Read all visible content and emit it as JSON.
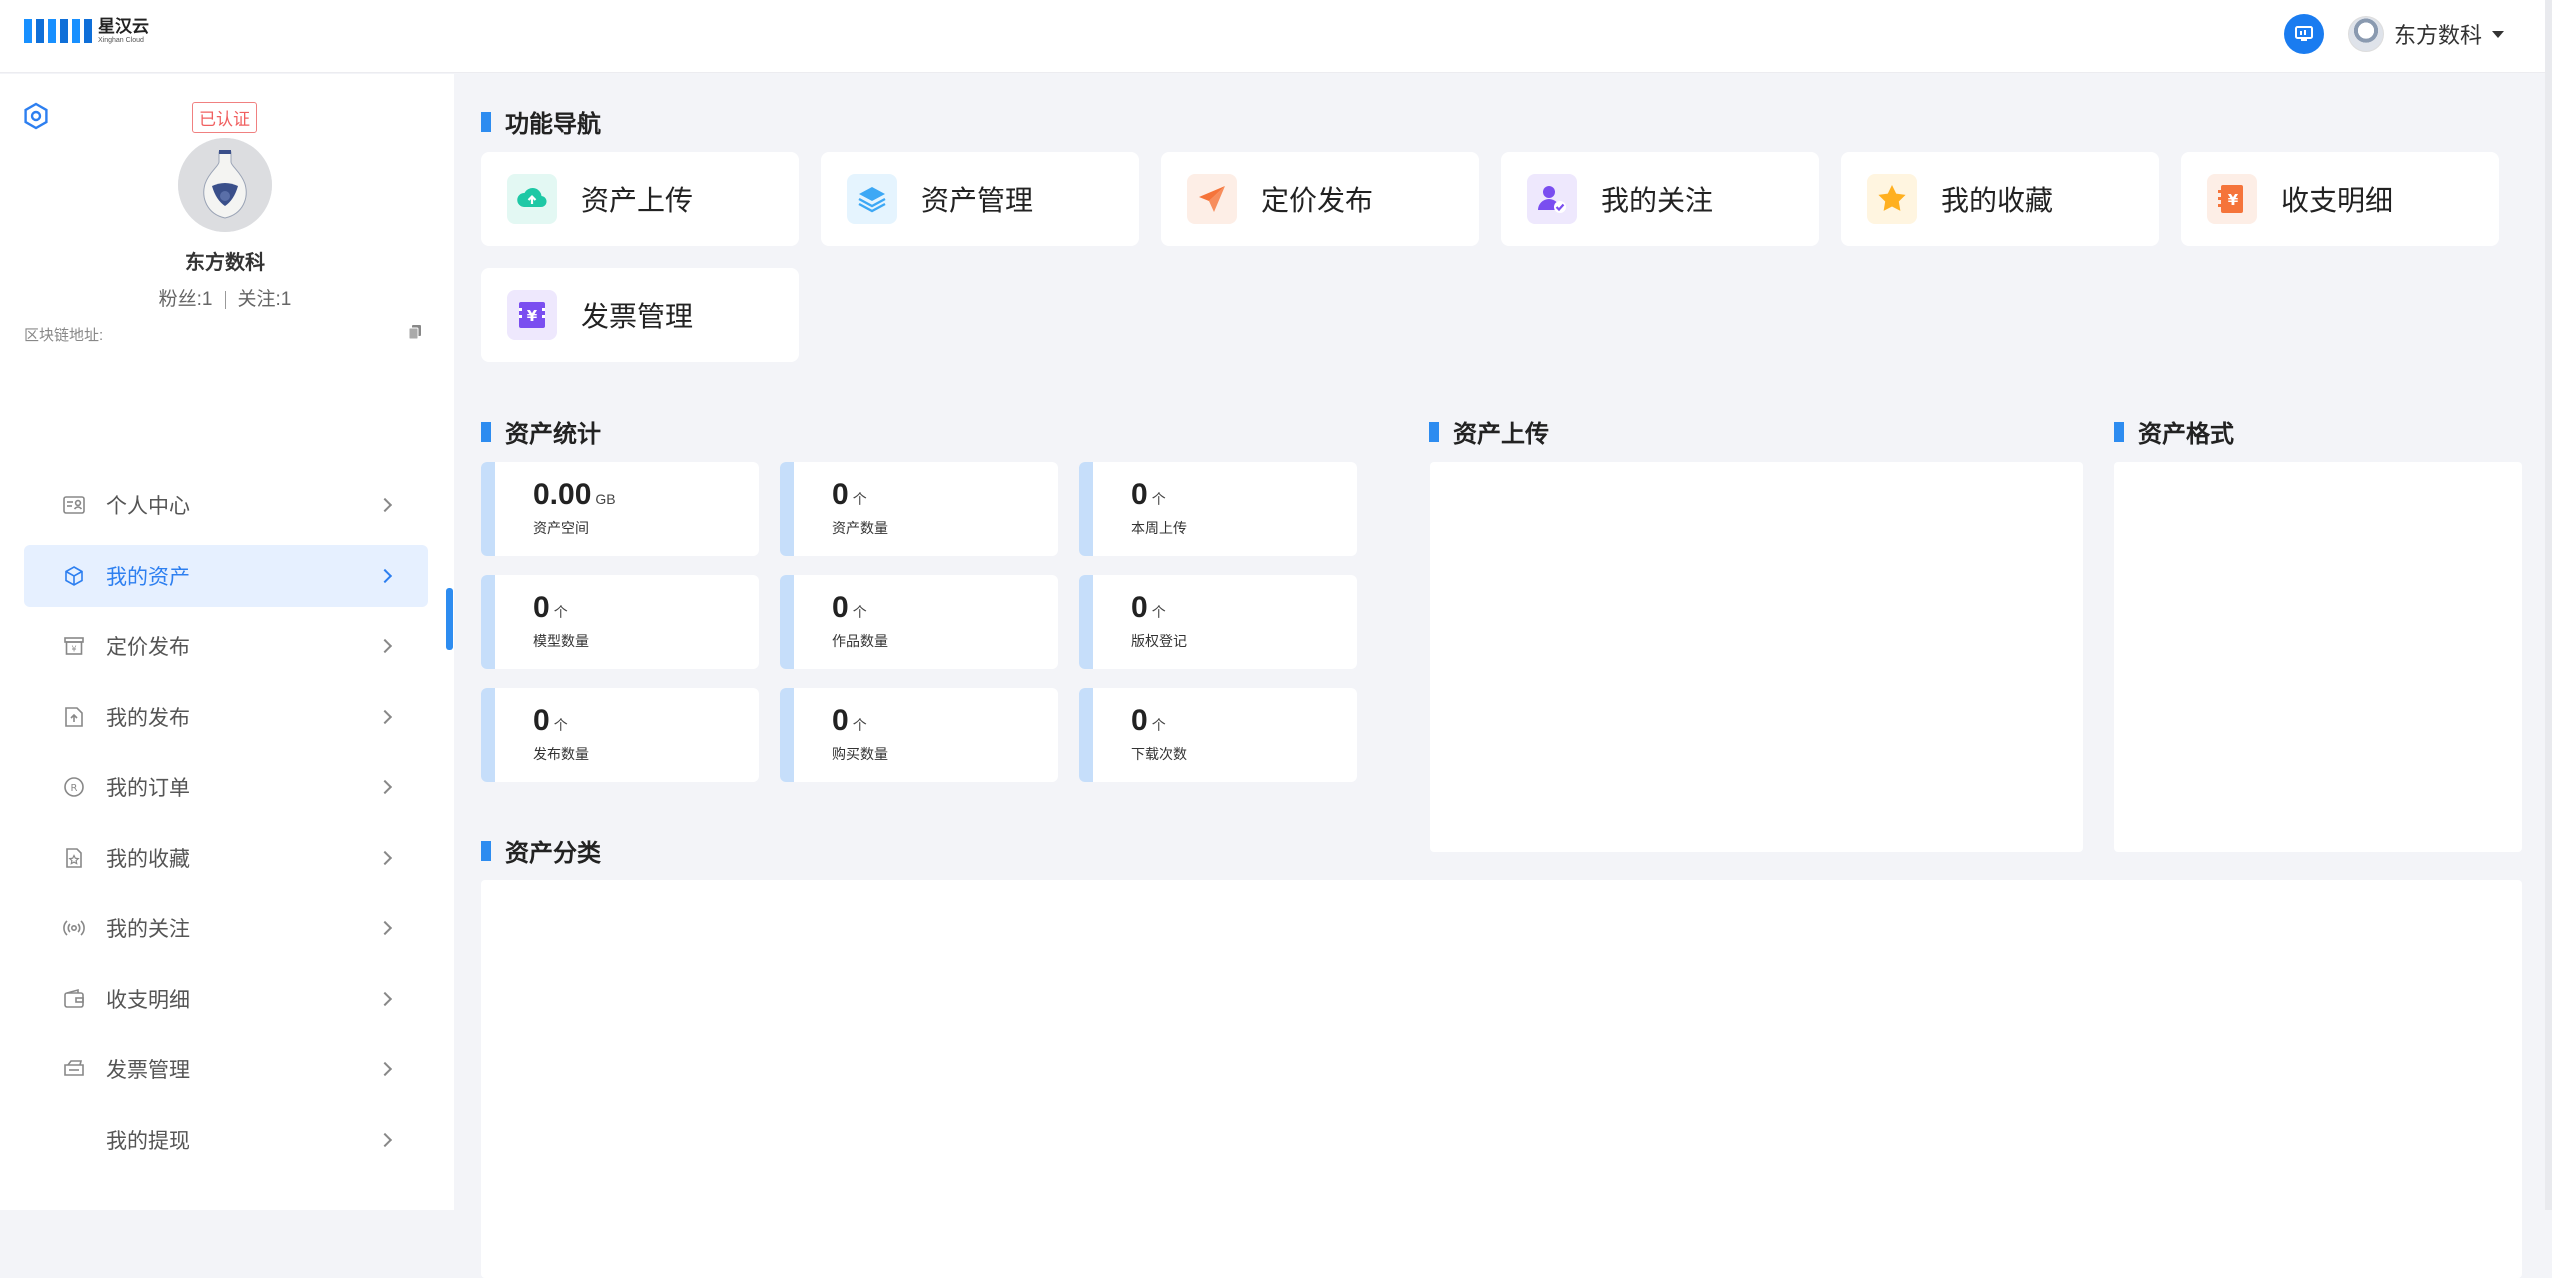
{
  "header": {
    "logo_cn": "星汉云",
    "logo_en": "Xinghan Cloud",
    "user_name": "东方数科"
  },
  "profile": {
    "cert_badge": "已认证",
    "name": "东方数科",
    "fans": "粉丝:1",
    "follow": "关注:1",
    "chain_label": "区块链地址:"
  },
  "sidebar": {
    "items": [
      {
        "label": "个人中心",
        "icon": "id-card-icon"
      },
      {
        "label": "我的资产",
        "icon": "cube-icon"
      },
      {
        "label": "定价发布",
        "icon": "price-tag-icon"
      },
      {
        "label": "我的发布",
        "icon": "upload-folder-icon"
      },
      {
        "label": "我的订单",
        "icon": "order-icon"
      },
      {
        "label": "我的收藏",
        "icon": "star-doc-icon"
      },
      {
        "label": "我的关注",
        "icon": "broadcast-icon"
      },
      {
        "label": "收支明细",
        "icon": "wallet-icon"
      },
      {
        "label": "发票管理",
        "icon": "invoice-icon"
      },
      {
        "label": "我的提现",
        "icon": ""
      }
    ],
    "active_index": 1
  },
  "sections": {
    "nav_title": "功能导航",
    "stats_title": "资产统计",
    "upload_title": "资产上传",
    "format_title": "资产格式",
    "category_title": "资产分类"
  },
  "nav_cards": [
    {
      "label": "资产上传",
      "icon": "cloud-upload-icon",
      "color": "#1ec8a5",
      "bg": "#e3f8f3"
    },
    {
      "label": "资产管理",
      "icon": "layers-icon",
      "color": "#3da8f5",
      "bg": "#e5f4fe"
    },
    {
      "label": "定价发布",
      "icon": "paper-plane-icon",
      "color": "#f5743a",
      "bg": "#fdeee6"
    },
    {
      "label": "我的关注",
      "icon": "user-check-icon",
      "color": "#7a4ef0",
      "bg": "#eee8fd"
    },
    {
      "label": "我的收藏",
      "icon": "star-icon",
      "color": "#ffb020",
      "bg": "#fff5e0"
    },
    {
      "label": "收支明细",
      "icon": "yuan-book-icon",
      "color": "#f5743a",
      "bg": "#fdeee6"
    },
    {
      "label": "发票管理",
      "icon": "invoice-yuan-icon",
      "color": "#7a4ef0",
      "bg": "#eee8fd"
    }
  ],
  "stats": [
    {
      "value": "0.00",
      "unit": "GB",
      "label": "资产空间"
    },
    {
      "value": "0",
      "unit": "个",
      "label": "资产数量"
    },
    {
      "value": "0",
      "unit": "个",
      "label": "本周上传"
    },
    {
      "value": "0",
      "unit": "个",
      "label": "模型数量"
    },
    {
      "value": "0",
      "unit": "个",
      "label": "作品数量"
    },
    {
      "value": "0",
      "unit": "个",
      "label": "版权登记"
    },
    {
      "value": "0",
      "unit": "个",
      "label": "发布数量"
    },
    {
      "value": "0",
      "unit": "个",
      "label": "购买数量"
    },
    {
      "value": "0",
      "unit": "个",
      "label": "下载次数"
    }
  ]
}
